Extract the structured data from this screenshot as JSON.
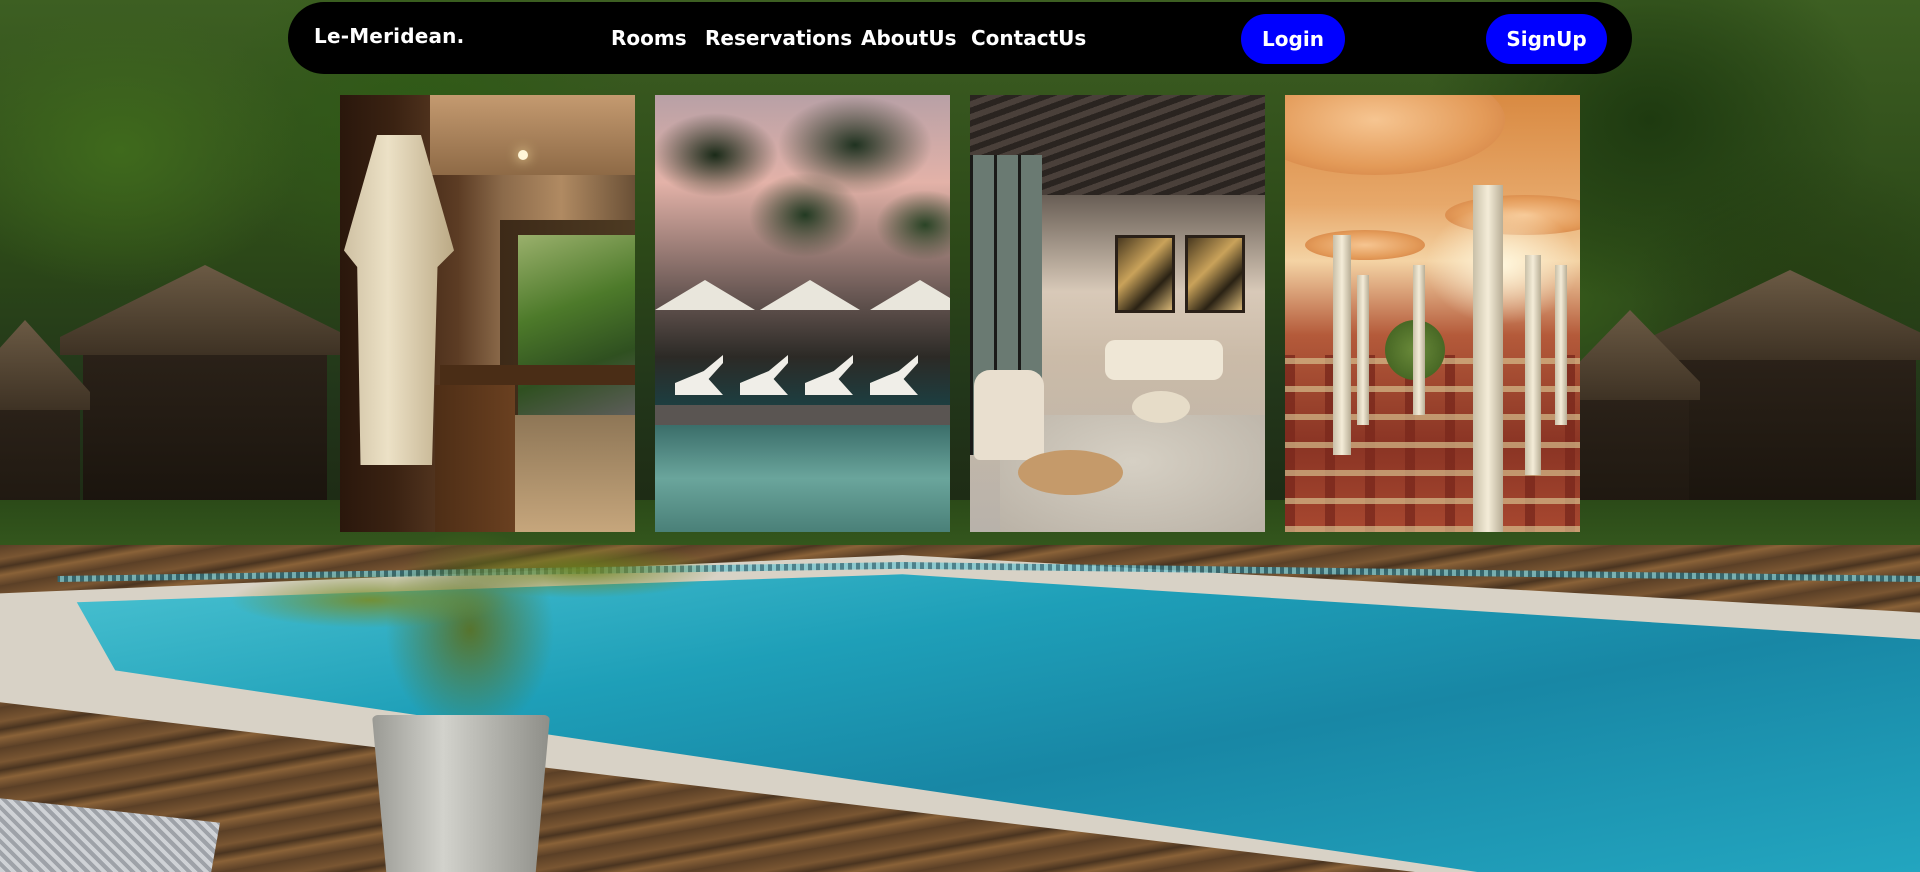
{
  "navbar": {
    "brand": "Le-Meridean.",
    "links": [
      {
        "label": "Rooms"
      },
      {
        "label": "Reservations"
      },
      {
        "label": "AboutUs"
      },
      {
        "label": "ContactUs"
      }
    ],
    "login_label": "Login",
    "signup_label": "SignUp"
  },
  "gallery": {
    "photos": [
      {
        "subject": "hotel room with bathrobe"
      },
      {
        "subject": "resort pool with palm trees at dusk"
      },
      {
        "subject": "hotel lounge with sofa and armchairs"
      },
      {
        "subject": "atrium with columns"
      }
    ]
  },
  "colors": {
    "nav_background": "#000000",
    "button_background": "#0000ff",
    "text": "#ffffff"
  }
}
